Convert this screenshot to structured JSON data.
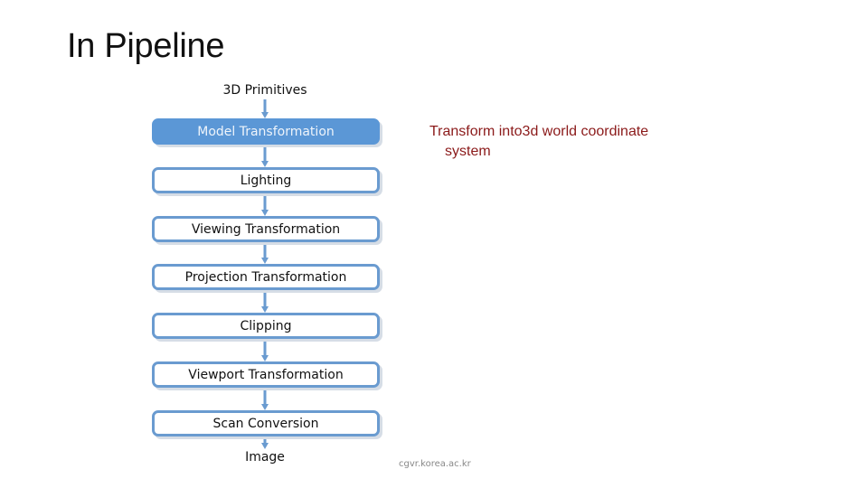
{
  "slide": {
    "title": "In Pipeline",
    "input_label": "3D Primitives",
    "output_label": "Image",
    "stages": [
      {
        "label": "Model Transformation",
        "highlighted": true
      },
      {
        "label": "Lighting",
        "highlighted": false
      },
      {
        "label": "Viewing Transformation",
        "highlighted": false
      },
      {
        "label": "Projection Transformation",
        "highlighted": false
      },
      {
        "label": "Clipping",
        "highlighted": false
      },
      {
        "label": "Viewport Transformation",
        "highlighted": false
      },
      {
        "label": "Scan Conversion",
        "highlighted": false
      }
    ],
    "note": {
      "line1": "Transform into3d world coordinate",
      "line2": "system"
    },
    "footer": "cgvr.korea.ac.kr",
    "colors": {
      "accent": "#5b97d6",
      "box_border": "#6a9bd0",
      "note_text": "#8b1a1a"
    }
  }
}
